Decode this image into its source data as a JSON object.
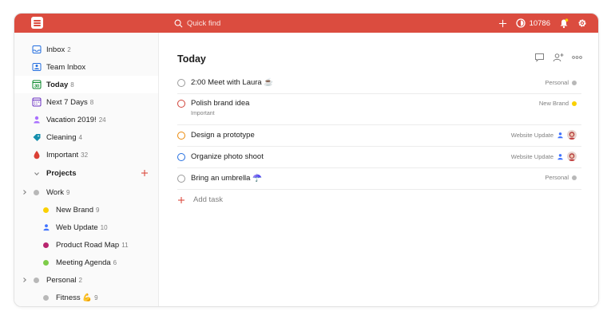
{
  "topbar": {
    "search_placeholder": "Quick find",
    "karma": "10786"
  },
  "sidebar": {
    "inbox": {
      "label": "Inbox",
      "count": "2"
    },
    "team_inbox": {
      "label": "Team Inbox"
    },
    "today": {
      "label": "Today",
      "count": "8"
    },
    "next7": {
      "label": "Next 7 Days",
      "count": "8"
    },
    "vacation": {
      "label": "Vacation 2019!",
      "count": "24"
    },
    "cleaning": {
      "label": "Cleaning",
      "count": "4"
    },
    "important": {
      "label": "Important",
      "count": "32"
    },
    "projects_header": "Projects",
    "projects": [
      {
        "label": "Work",
        "count": "9"
      },
      {
        "label": "New Brand",
        "count": "9"
      },
      {
        "label": "Web Update",
        "count": "10"
      },
      {
        "label": "Product Road Map",
        "count": "11"
      },
      {
        "label": "Meeting Agenda",
        "count": "6"
      },
      {
        "label": "Personal",
        "count": "2"
      },
      {
        "label": "Fitness 💪",
        "count": "9"
      }
    ]
  },
  "main": {
    "title": "Today",
    "tasks": [
      {
        "name": "2:00 Meet with Laura ☕",
        "project": "Personal"
      },
      {
        "name": "Polish brand idea",
        "sub": "Important",
        "project": "New Brand"
      },
      {
        "name": "Design a prototype",
        "project": "Website Update"
      },
      {
        "name": "Organize photo shoot",
        "project": "Website Update"
      },
      {
        "name": "Bring an umbrella ☂️",
        "project": "Personal"
      }
    ],
    "add_task": "Add task"
  },
  "colors": {
    "brand": "#db4c3f",
    "inbox": "#246fe0",
    "today": "#058527",
    "next7": "#692fc2",
    "vacation": "#a970ff",
    "cleaning": "#158fad",
    "important": "#db4035",
    "work": "#b8b8b8",
    "new_brand": "#fad000",
    "web_update": "#4073ff",
    "product_road_map": "#b8256f",
    "meeting_agenda": "#7ecc49",
    "personal": "#b8b8b8",
    "priority1": "#d1453b",
    "priority2": "#eb8909",
    "priority3": "#246fe0"
  }
}
